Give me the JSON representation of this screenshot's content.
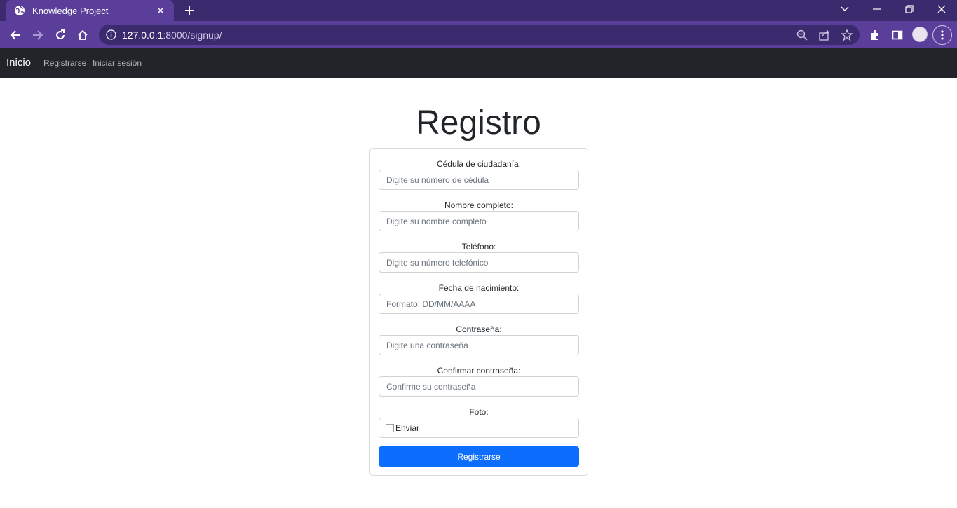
{
  "browser": {
    "tab_title": "Knowledge Project",
    "url_host": "127.0.0.1",
    "url_path": ":8000/signup/"
  },
  "navbar": {
    "brand": "Inicio",
    "links": [
      "Registrarse",
      "Iniciar sesión"
    ]
  },
  "form": {
    "title": "Registro",
    "fields": [
      {
        "label": "Cédula de ciudadanía:",
        "placeholder": "Digite su número de cédula"
      },
      {
        "label": "Nombre completo:",
        "placeholder": "Digite su nombre completo"
      },
      {
        "label": "Teléfono:",
        "placeholder": "Digite su número telefónico"
      },
      {
        "label": "Fecha de nacimiento:",
        "placeholder": "Formato: DD/MM/AAAA"
      },
      {
        "label": "Contraseña:",
        "placeholder": "Digite una contraseña"
      },
      {
        "label": "Confirmar contraseña:",
        "placeholder": "Confirme su contraseña"
      }
    ],
    "photo_label": "Foto:",
    "photo_alt": "Enviar",
    "submit_label": "Registrarse"
  },
  "colors": {
    "tabstrip": "#3b2a6e",
    "toolbar": "#5a3e9a",
    "navbar": "#212529",
    "primary": "#0d6efd"
  }
}
